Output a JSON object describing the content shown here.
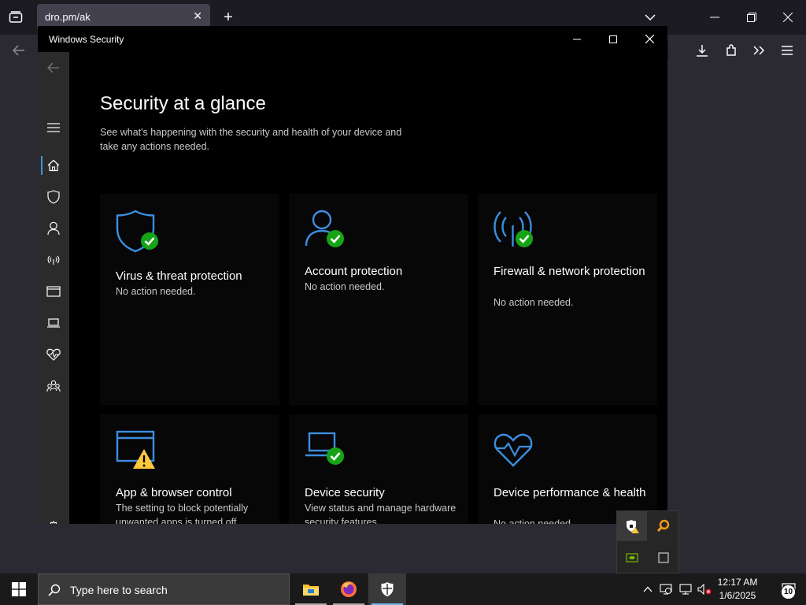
{
  "browser": {
    "tab_title": "dro.pm/ak"
  },
  "window": {
    "title": "Windows Security"
  },
  "main": {
    "title": "Security at a glance",
    "description": "See what's happening with the security and health of your device and take any actions needed."
  },
  "cards": [
    {
      "title": "Virus & threat protection",
      "status": "No action needed.",
      "icon": "shield-check-icon",
      "state": "ok"
    },
    {
      "title": "Account protection",
      "status": "No action needed.",
      "icon": "person-check-icon",
      "state": "ok"
    },
    {
      "title": "Firewall & network protection",
      "status": "No action needed.",
      "icon": "antenna-check-icon",
      "state": "ok"
    },
    {
      "title": "App & browser control",
      "status": "The setting to block potentially unwanted apps is turned off.",
      "icon": "browser-warning-icon",
      "state": "warning"
    },
    {
      "title": "Device security",
      "status": "View status and manage hardware security features",
      "icon": "laptop-check-icon",
      "state": "ok"
    },
    {
      "title": "Device performance & health",
      "status": "No action needed.",
      "icon": "heart-pulse-icon",
      "state": "ok"
    }
  ],
  "taskbar": {
    "search_placeholder": "Type here to search",
    "time": "12:17 AM",
    "date": "1/6/2025",
    "notification_count": "10"
  },
  "colors": {
    "accent": "#3a96dd",
    "ok": "#16a417",
    "warning": "#ffc83d",
    "icon_blue": "#3c8ee0"
  }
}
